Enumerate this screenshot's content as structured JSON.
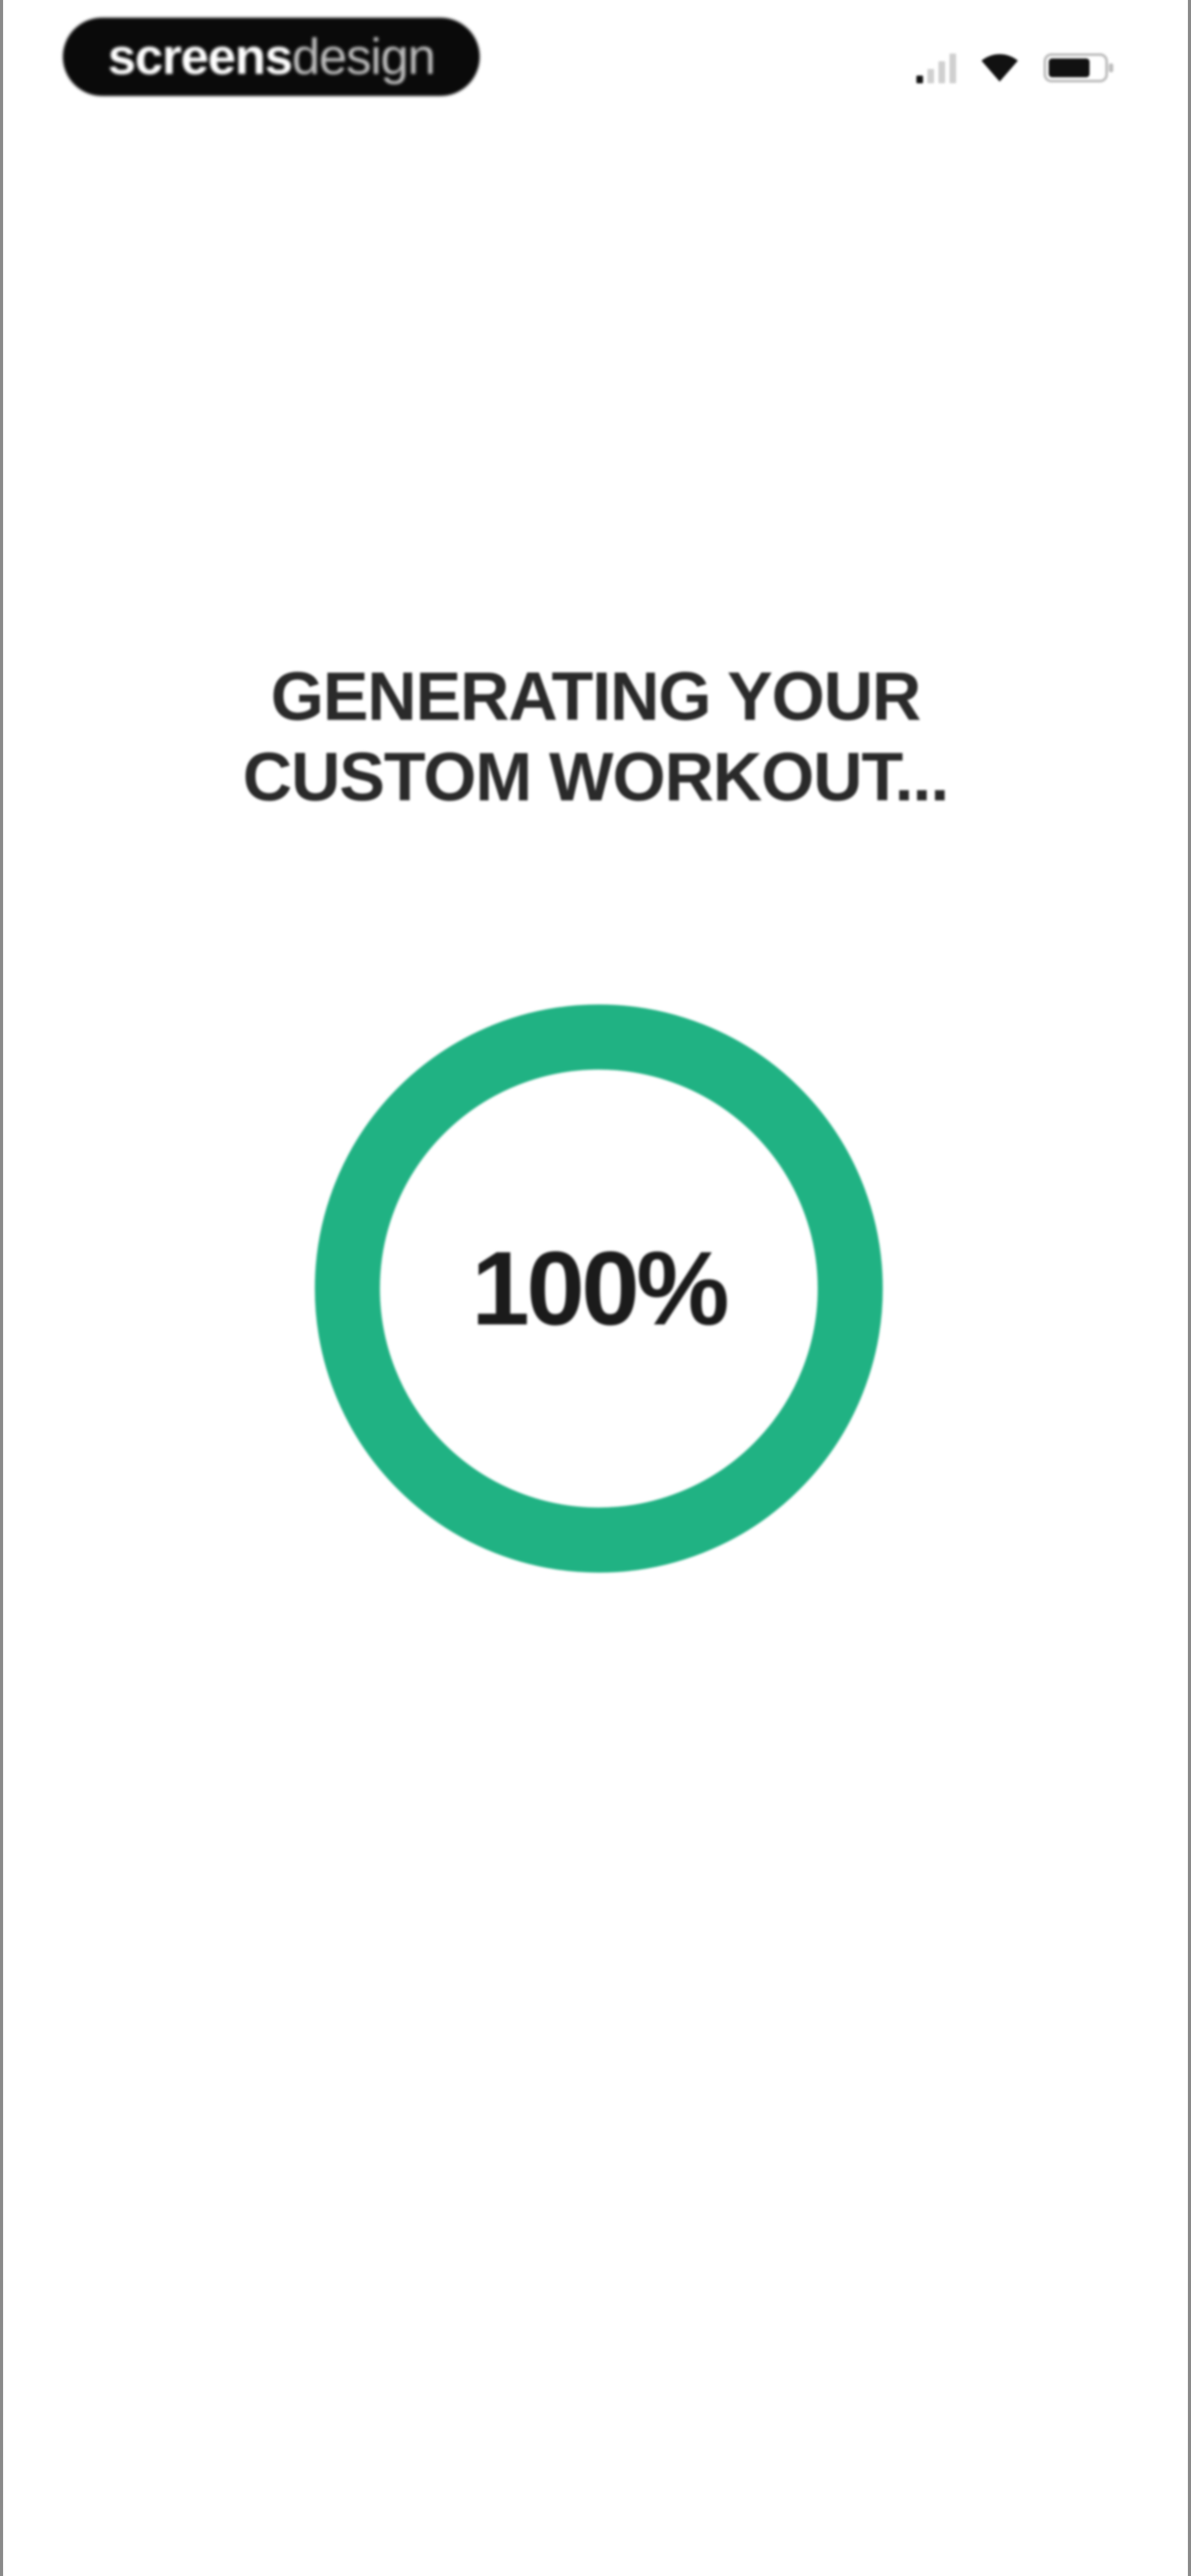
{
  "status_bar": {
    "brand": {
      "bold_part": "screens",
      "light_part": "design"
    },
    "icons": [
      "cellular-signal-icon",
      "wifi-icon",
      "battery-icon"
    ]
  },
  "loading": {
    "headline_line1": "GENERATING YOUR",
    "headline_line2": "CUSTOM WORKOUT...",
    "progress_label": "100%",
    "progress_fraction": 1.0
  },
  "colors": {
    "accent": "#20b283",
    "background": "#ffffff",
    "text": "#2a2a2a",
    "brand_pill": "#0a0a0a"
  }
}
